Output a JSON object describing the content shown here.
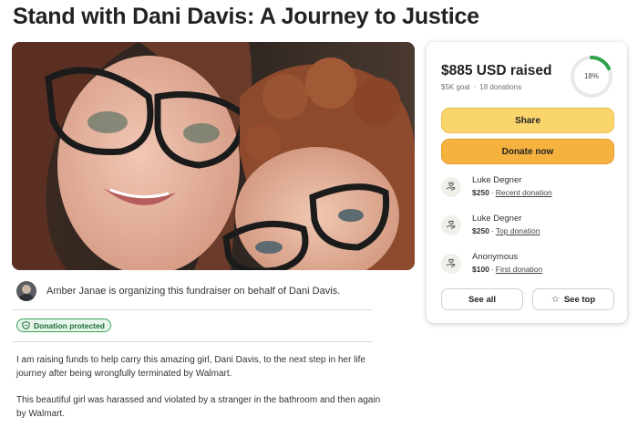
{
  "page": {
    "title": "Stand with Dani Davis: A Journey to Justice"
  },
  "organizer": {
    "text": "Amber Janae is organizing this fundraiser on behalf of Dani Davis."
  },
  "badge": {
    "label": "Donation protected",
    "icon": "shield-icon"
  },
  "story": {
    "paragraph1": "I am raising funds to help carry this amazing girl, Dani Davis, to the next step in her life journey after being wrongfully terminated by Walmart.",
    "paragraph2": "This beautiful girl was harassed and violated by a stranger in the bathroom and then again by Walmart."
  },
  "card": {
    "raised": "$885 USD raised",
    "goal": "$5K goal",
    "separator": "·",
    "donation_count": "18 donations",
    "progress_label": "18%",
    "progress_fraction": 0.18,
    "progress_color": "#2ca34a",
    "share_label": "Share",
    "donate_label": "Donate now",
    "donations": [
      {
        "name": "Luke Degner",
        "amount": "$250",
        "tag": "Recent donation"
      },
      {
        "name": "Luke Degner",
        "amount": "$250",
        "tag": "Top donation"
      },
      {
        "name": "Anonymous",
        "amount": "$100",
        "tag": "First donation"
      }
    ],
    "meta_separator": "·",
    "see_all_label": "See all",
    "see_top_label": "See top",
    "see_top_icon": "star-icon"
  },
  "colors": {
    "share": "#f9d56c",
    "donate": "#f6b23f",
    "protected_badge": "#e7f6ea"
  }
}
